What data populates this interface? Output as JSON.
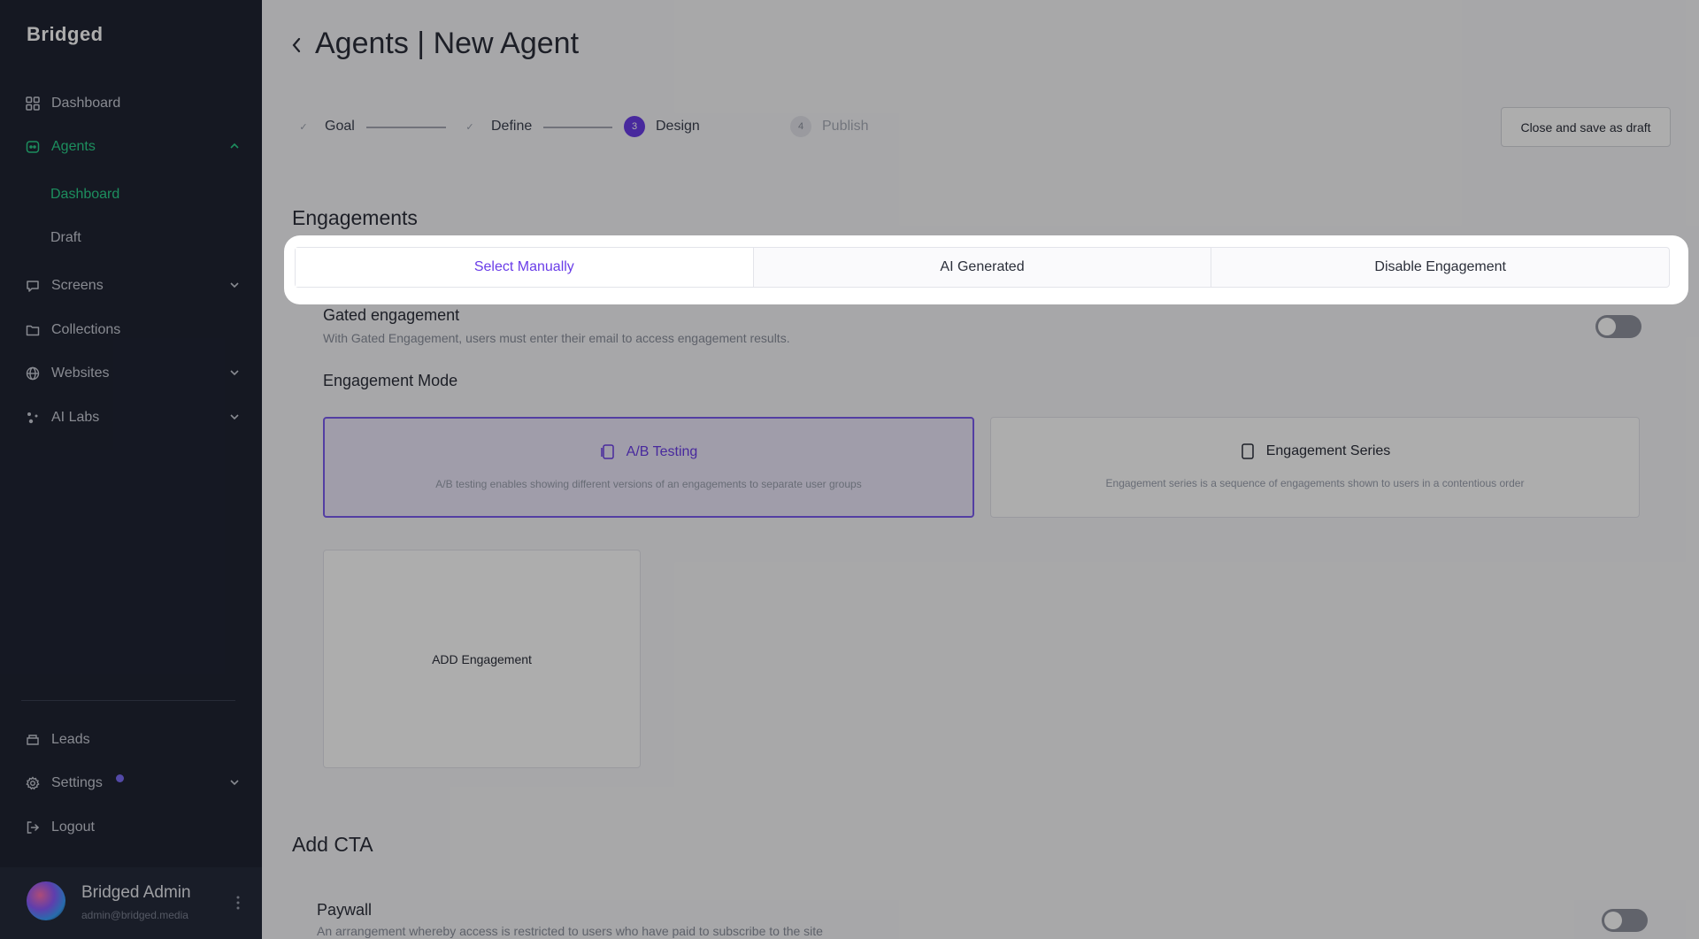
{
  "brand": "Bridged",
  "sidebar": {
    "items": [
      {
        "label": "Dashboard"
      },
      {
        "label": "Agents"
      },
      {
        "label": "Screens"
      },
      {
        "label": "Collections"
      },
      {
        "label": "Websites"
      },
      {
        "label": "AI Labs"
      }
    ],
    "agents_sub": [
      {
        "label": "Dashboard"
      },
      {
        "label": "Draft"
      }
    ],
    "bottom_items": [
      {
        "label": "Leads"
      },
      {
        "label": "Settings"
      },
      {
        "label": "Logout"
      }
    ],
    "user": {
      "name": "Bridged Admin",
      "email": "admin@bridged.media"
    },
    "accent_color": "#2bd18b"
  },
  "header": {
    "title": "Agents | New Agent",
    "close_draft_label": "Close and save as draft"
  },
  "steps": [
    {
      "label": "Goal",
      "state": "done",
      "mark": "✓"
    },
    {
      "label": "Define",
      "state": "done",
      "mark": "✓"
    },
    {
      "label": "Design",
      "state": "current",
      "mark": "3"
    },
    {
      "label": "Publish",
      "state": "todo",
      "mark": "4"
    }
  ],
  "engagements": {
    "title": "Engagements",
    "tabs": [
      {
        "label": "Select Manually",
        "selected": true
      },
      {
        "label": "AI Generated",
        "selected": false
      },
      {
        "label": "Disable Engagement",
        "selected": false
      }
    ],
    "gated": {
      "title": "Gated engagement",
      "description": "With Gated Engagement, users must enter their email to access engagement results.",
      "enabled": false
    },
    "mode_title": "Engagement Mode",
    "modes": [
      {
        "label": "A/B Testing",
        "description": "A/B testing enables showing different versions of an engagements to separate user groups",
        "selected": true
      },
      {
        "label": "Engagement Series",
        "description": "Engagement series is a sequence of engagements shown to users in a contentious order",
        "selected": false
      }
    ],
    "add_label": "ADD Engagement"
  },
  "cta": {
    "title": "Add CTA",
    "paywall": {
      "title": "Paywall",
      "description": "An arrangement whereby access is restricted to users who have paid to subscribe to the site",
      "enabled": false
    }
  },
  "colors": {
    "primary": "#6a3de8",
    "sidebar_bg": "#1f2433"
  }
}
